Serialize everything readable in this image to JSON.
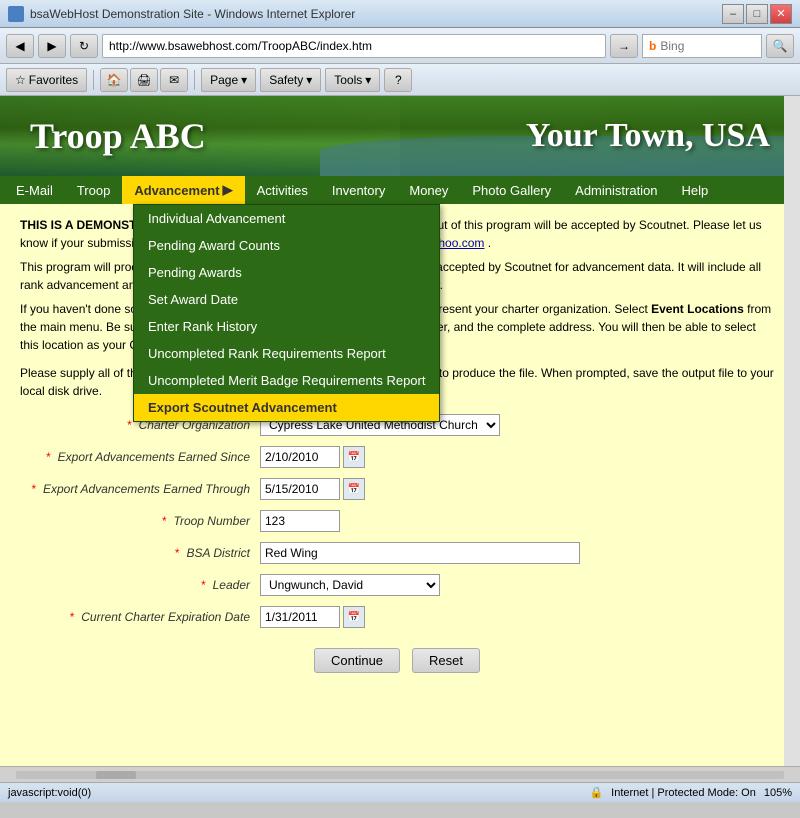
{
  "browser": {
    "title": "bsaWebHost Demonstration Site - Windows Internet Explorer",
    "address": "http://www.bsawebhost.com/TroopABC/index.htm",
    "search_placeholder": "Bing",
    "back_icon": "◀",
    "forward_icon": "▶",
    "refresh_icon": "↻",
    "stop_icon": "✕",
    "minimize_label": "–",
    "maximize_label": "□",
    "close_label": "✕"
  },
  "toolbar": {
    "favorites_label": "Favorites",
    "page_label": "Page",
    "safety_label": "Safety",
    "tools_label": "Tools",
    "help_icon": "?",
    "dropdown_arrow": "▾"
  },
  "banner": {
    "left_title": "Troop ABC",
    "right_title": "Your Town, USA"
  },
  "nav": {
    "items": [
      {
        "label": "E-Mail",
        "active": false
      },
      {
        "label": "Troop",
        "active": false
      },
      {
        "label": "Advancement",
        "active": true,
        "has_arrow": true
      },
      {
        "label": "Activities",
        "active": false
      },
      {
        "label": "Inventory",
        "active": false
      },
      {
        "label": "Money",
        "active": false
      },
      {
        "label": "Photo Gallery",
        "active": false
      },
      {
        "label": "Administration",
        "active": false
      },
      {
        "label": "Help",
        "active": false
      }
    ]
  },
  "dropdown": {
    "items": [
      {
        "label": "Individual Advancement",
        "highlighted": false
      },
      {
        "label": "Pending Award Counts",
        "highlighted": false
      },
      {
        "label": "Pending Awards",
        "highlighted": false
      },
      {
        "label": "Set Award Date",
        "highlighted": false
      },
      {
        "label": "Enter Rank History",
        "highlighted": false
      },
      {
        "label": "Uncompleted Rank Requirements Report",
        "highlighted": false
      },
      {
        "label": "Uncompleted Merit Badge Requirements Report",
        "highlighted": false
      },
      {
        "label": "Export Scoutnet Advancement",
        "highlighted": true
      }
    ]
  },
  "notice": {
    "prefix": "THIS IS A DEMONSTRATION SITE.",
    "text": " We do not yet know for sure that the output of this program will be accepted by Scoutnet. Please let us know if your submission is successful by sending an e-mail to ",
    "email": "bsawebhost@yahoo.com",
    "suffix": ".",
    "para2": "This program will produce a CSV file in a format designed to match the format accepted by Scoutnet for advancement data. It will include all rank advancement and merit badges earned within the dates you specify below.",
    "para3_prefix": "If you haven't done so already, you will need to create an Event Location to represent your charter organization. Select ",
    "para3_link": "Event Locations",
    "para3_mid": " from the main menu. Be sure to include the organization name, the telephone number, and the complete address. You will then be able to select this location as your Charter Organization."
  },
  "form": {
    "intro": "Please supply all of the information requested below and then press Continue to produce the file. When prompted, save the output file to your local disk drive.",
    "fields": {
      "charter_org_label": "Charter Organization",
      "charter_org_value": "Cypress Lake United Methodist Church",
      "charter_org_options": [
        "Cypress Lake United Methodist Church"
      ],
      "earned_since_label": "Export Advancements Earned Since",
      "earned_since_value": "2/10/2010",
      "earned_through_label": "Export Advancements Earned Through",
      "earned_through_value": "5/15/2010",
      "troop_number_label": "Troop Number",
      "troop_number_value": "123",
      "bsa_district_label": "BSA District",
      "bsa_district_value": "Red Wing",
      "leader_label": "Leader",
      "leader_value": "Ungwunch, David",
      "leader_options": [
        "Ungwunch, David"
      ],
      "expiration_label": "Current Charter Expiration Date",
      "expiration_value": "1/31/2011"
    },
    "continue_label": "Continue",
    "reset_label": "Reset"
  },
  "status_bar": {
    "url": "javascript:void(0)",
    "protected_mode": "Internet | Protected Mode: On",
    "zoom": "105%"
  }
}
